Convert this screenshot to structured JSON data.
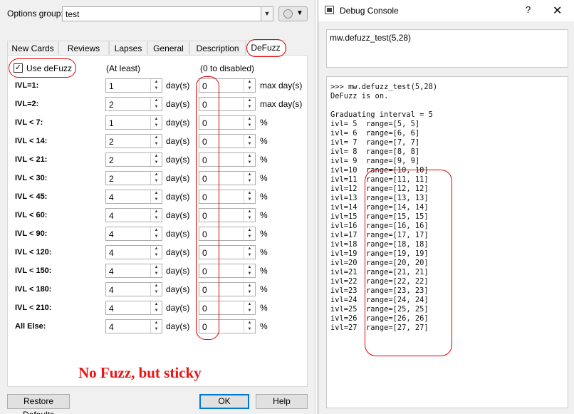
{
  "options": {
    "group_label": "Options group:",
    "group_value": "test",
    "tabs": [
      "New Cards",
      "Reviews",
      "Lapses",
      "General",
      "Description",
      "DeFuzz"
    ],
    "use_defuzz_label": "Use deFuzz",
    "use_defuzz_checked": true,
    "col_at_least": "(At least)",
    "col_disable": "(0 to disabled)",
    "rows": [
      {
        "label": "IVL=1:",
        "value": "1",
        "unit": "day(s)",
        "fuzz": "0",
        "fuzz_unit": "max day(s)"
      },
      {
        "label": "IVL=2:",
        "value": "2",
        "unit": "day(s)",
        "fuzz": "0",
        "fuzz_unit": "max day(s)"
      },
      {
        "label": "IVL < 7:",
        "value": "1",
        "unit": "day(s)",
        "fuzz": "0",
        "fuzz_unit": "%"
      },
      {
        "label": "IVL < 14:",
        "value": "2",
        "unit": "day(s)",
        "fuzz": "0",
        "fuzz_unit": "%"
      },
      {
        "label": "IVL < 21:",
        "value": "2",
        "unit": "day(s)",
        "fuzz": "0",
        "fuzz_unit": "%"
      },
      {
        "label": "IVL < 30:",
        "value": "2",
        "unit": "day(s)",
        "fuzz": "0",
        "fuzz_unit": "%"
      },
      {
        "label": "IVL < 45:",
        "value": "4",
        "unit": "day(s)",
        "fuzz": "0",
        "fuzz_unit": "%"
      },
      {
        "label": "IVL < 60:",
        "value": "4",
        "unit": "day(s)",
        "fuzz": "0",
        "fuzz_unit": "%"
      },
      {
        "label": "IVL < 90:",
        "value": "4",
        "unit": "day(s)",
        "fuzz": "0",
        "fuzz_unit": "%"
      },
      {
        "label": "IVL < 120:",
        "value": "4",
        "unit": "day(s)",
        "fuzz": "0",
        "fuzz_unit": "%"
      },
      {
        "label": "IVL < 150:",
        "value": "4",
        "unit": "day(s)",
        "fuzz": "0",
        "fuzz_unit": "%"
      },
      {
        "label": "IVL < 180:",
        "value": "4",
        "unit": "day(s)",
        "fuzz": "0",
        "fuzz_unit": "%"
      },
      {
        "label": "IVL < 210:",
        "value": "4",
        "unit": "day(s)",
        "fuzz": "0",
        "fuzz_unit": "%"
      },
      {
        "label": "All Else:",
        "value": "4",
        "unit": "day(s)",
        "fuzz": "0",
        "fuzz_unit": "%"
      }
    ],
    "annotation": "No Fuzz, but sticky",
    "restore_defaults_label": "Restore Defaults",
    "ok_label": "OK",
    "help_label": "Help"
  },
  "debug_console": {
    "title": "Debug Console",
    "help_glyph": "?",
    "close_glyph": "✕",
    "input": "mw.defuzz_test(5,28)",
    "output_lines": [
      ">>> mw.defuzz_test(5,28)",
      "DeFuzz is on.",
      "",
      "Graduating interval = 5",
      "ivl= 5  range=[5, 5]",
      "ivl= 6  range=[6, 6]",
      "ivl= 7  range=[7, 7]",
      "ivl= 8  range=[8, 8]",
      "ivl= 9  range=[9, 9]",
      "ivl=10  range=[10, 10]",
      "ivl=11  range=[11, 11]",
      "ivl=12  range=[12, 12]",
      "ivl=13  range=[13, 13]",
      "ivl=14  range=[14, 14]",
      "ivl=15  range=[15, 15]",
      "ivl=16  range=[16, 16]",
      "ivl=17  range=[17, 17]",
      "ivl=18  range=[18, 18]",
      "ivl=19  range=[19, 19]",
      "ivl=20  range=[20, 20]",
      "ivl=21  range=[21, 21]",
      "ivl=22  range=[22, 22]",
      "ivl=23  range=[23, 23]",
      "ivl=24  range=[24, 24]",
      "ivl=25  range=[25, 25]",
      "ivl=26  range=[26, 26]",
      "ivl=27  range=[27, 27]"
    ]
  },
  "colors": {
    "annotation_red": "#e00000",
    "accent_blue": "#0078d7"
  }
}
